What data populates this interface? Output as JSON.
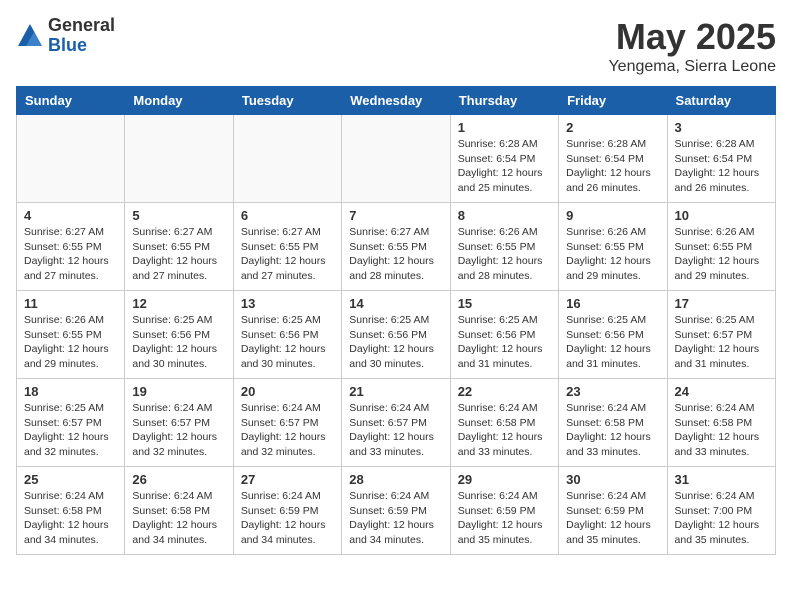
{
  "logo": {
    "general": "General",
    "blue": "Blue"
  },
  "title": "May 2025",
  "location": "Yengema, Sierra Leone",
  "days_of_week": [
    "Sunday",
    "Monday",
    "Tuesday",
    "Wednesday",
    "Thursday",
    "Friday",
    "Saturday"
  ],
  "weeks": [
    [
      {
        "day": "",
        "info": ""
      },
      {
        "day": "",
        "info": ""
      },
      {
        "day": "",
        "info": ""
      },
      {
        "day": "",
        "info": ""
      },
      {
        "day": "1",
        "info": "Sunrise: 6:28 AM\nSunset: 6:54 PM\nDaylight: 12 hours and 25 minutes."
      },
      {
        "day": "2",
        "info": "Sunrise: 6:28 AM\nSunset: 6:54 PM\nDaylight: 12 hours and 26 minutes."
      },
      {
        "day": "3",
        "info": "Sunrise: 6:28 AM\nSunset: 6:54 PM\nDaylight: 12 hours and 26 minutes."
      }
    ],
    [
      {
        "day": "4",
        "info": "Sunrise: 6:27 AM\nSunset: 6:55 PM\nDaylight: 12 hours and 27 minutes."
      },
      {
        "day": "5",
        "info": "Sunrise: 6:27 AM\nSunset: 6:55 PM\nDaylight: 12 hours and 27 minutes."
      },
      {
        "day": "6",
        "info": "Sunrise: 6:27 AM\nSunset: 6:55 PM\nDaylight: 12 hours and 27 minutes."
      },
      {
        "day": "7",
        "info": "Sunrise: 6:27 AM\nSunset: 6:55 PM\nDaylight: 12 hours and 28 minutes."
      },
      {
        "day": "8",
        "info": "Sunrise: 6:26 AM\nSunset: 6:55 PM\nDaylight: 12 hours and 28 minutes."
      },
      {
        "day": "9",
        "info": "Sunrise: 6:26 AM\nSunset: 6:55 PM\nDaylight: 12 hours and 29 minutes."
      },
      {
        "day": "10",
        "info": "Sunrise: 6:26 AM\nSunset: 6:55 PM\nDaylight: 12 hours and 29 minutes."
      }
    ],
    [
      {
        "day": "11",
        "info": "Sunrise: 6:26 AM\nSunset: 6:55 PM\nDaylight: 12 hours and 29 minutes."
      },
      {
        "day": "12",
        "info": "Sunrise: 6:25 AM\nSunset: 6:56 PM\nDaylight: 12 hours and 30 minutes."
      },
      {
        "day": "13",
        "info": "Sunrise: 6:25 AM\nSunset: 6:56 PM\nDaylight: 12 hours and 30 minutes."
      },
      {
        "day": "14",
        "info": "Sunrise: 6:25 AM\nSunset: 6:56 PM\nDaylight: 12 hours and 30 minutes."
      },
      {
        "day": "15",
        "info": "Sunrise: 6:25 AM\nSunset: 6:56 PM\nDaylight: 12 hours and 31 minutes."
      },
      {
        "day": "16",
        "info": "Sunrise: 6:25 AM\nSunset: 6:56 PM\nDaylight: 12 hours and 31 minutes."
      },
      {
        "day": "17",
        "info": "Sunrise: 6:25 AM\nSunset: 6:57 PM\nDaylight: 12 hours and 31 minutes."
      }
    ],
    [
      {
        "day": "18",
        "info": "Sunrise: 6:25 AM\nSunset: 6:57 PM\nDaylight: 12 hours and 32 minutes."
      },
      {
        "day": "19",
        "info": "Sunrise: 6:24 AM\nSunset: 6:57 PM\nDaylight: 12 hours and 32 minutes."
      },
      {
        "day": "20",
        "info": "Sunrise: 6:24 AM\nSunset: 6:57 PM\nDaylight: 12 hours and 32 minutes."
      },
      {
        "day": "21",
        "info": "Sunrise: 6:24 AM\nSunset: 6:57 PM\nDaylight: 12 hours and 33 minutes."
      },
      {
        "day": "22",
        "info": "Sunrise: 6:24 AM\nSunset: 6:58 PM\nDaylight: 12 hours and 33 minutes."
      },
      {
        "day": "23",
        "info": "Sunrise: 6:24 AM\nSunset: 6:58 PM\nDaylight: 12 hours and 33 minutes."
      },
      {
        "day": "24",
        "info": "Sunrise: 6:24 AM\nSunset: 6:58 PM\nDaylight: 12 hours and 33 minutes."
      }
    ],
    [
      {
        "day": "25",
        "info": "Sunrise: 6:24 AM\nSunset: 6:58 PM\nDaylight: 12 hours and 34 minutes."
      },
      {
        "day": "26",
        "info": "Sunrise: 6:24 AM\nSunset: 6:58 PM\nDaylight: 12 hours and 34 minutes."
      },
      {
        "day": "27",
        "info": "Sunrise: 6:24 AM\nSunset: 6:59 PM\nDaylight: 12 hours and 34 minutes."
      },
      {
        "day": "28",
        "info": "Sunrise: 6:24 AM\nSunset: 6:59 PM\nDaylight: 12 hours and 34 minutes."
      },
      {
        "day": "29",
        "info": "Sunrise: 6:24 AM\nSunset: 6:59 PM\nDaylight: 12 hours and 35 minutes."
      },
      {
        "day": "30",
        "info": "Sunrise: 6:24 AM\nSunset: 6:59 PM\nDaylight: 12 hours and 35 minutes."
      },
      {
        "day": "31",
        "info": "Sunrise: 6:24 AM\nSunset: 7:00 PM\nDaylight: 12 hours and 35 minutes."
      }
    ]
  ]
}
